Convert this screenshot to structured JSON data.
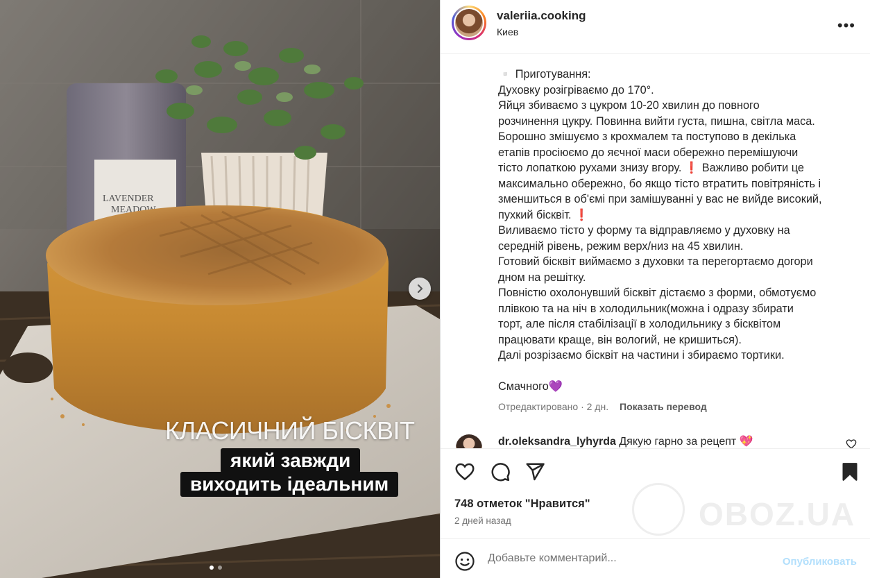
{
  "media": {
    "overlay_line1": "КЛАСИЧНИЙ БІСКВІТ",
    "overlay_line2": "який завжди",
    "overlay_line3": "виходить ідеальним",
    "jar_label_line1": "LAVENDER",
    "jar_label_line2": "MEADOW",
    "next_icon": "chevron-right-icon",
    "carousel_count": 2,
    "carousel_active": 1
  },
  "header": {
    "username": "valeriia.cooking",
    "location": "Киев",
    "more_icon": "more-horizontal-icon",
    "more_label": "•••"
  },
  "caption": {
    "lines": [
      "▫️ Приготування:",
      "Духовку розігріваємо до 170°.",
      "Яйця збиваємо з цукром 10-20 хвилин до повного",
      "розчинення цукру. Повинна вийти густа, пишна, світла маса.",
      "Борошно змішуємо з крохмалем та поступово в декілька",
      "етапів просіюємо до яєчної маси обережно перемішуючи",
      "тісто лопаткою рухами знизу вгору. ❗ Важливо робити це",
      "максимально обережно, бо якщо тісто втратить повітряність і",
      "зменшиться в об'ємі при замішуванні у вас не вийде високий,",
      "пухкий бісквіт. ❗",
      "Виливаємо тісто у форму та відправляємо у духовку на",
      "середній рівень, режим верх/низ на 45 хвилин.",
      "Готовий бісквіт виймаємо з духовки та перегортаємо догори",
      "дном на решітку.",
      "Повністю охолонувший бісквіт дістаємо з форми, обмотуємо",
      "плівкою та на ніч в холодильник(можна і одразу збирати",
      "торт, але після стабілізації в холодильнику з бісквітом",
      "працювати краще, він вологий, не кришиться).",
      "Далі розрізаємо бісквіт на частини і збираємо тортики."
    ],
    "closing": "Смачного💜",
    "edited": "Отредактировано · 2 дн.",
    "translate": "Показать перевод"
  },
  "comment": {
    "username": "dr.oleksandra_lyhyrda",
    "text": "Дякую гарно за рецепт 💖",
    "like_icon": "heart-outline-icon"
  },
  "actions": {
    "like_icon": "heart-icon",
    "comment_icon": "comment-icon",
    "share_icon": "share-icon",
    "save_icon": "bookmark-icon",
    "likes": "748 отметок \"Нравится\"",
    "date": "2 дней назад"
  },
  "watermark": {
    "text": "OBOZ.UA"
  },
  "comment_box": {
    "emoji_icon": "smiley-icon",
    "placeholder": "Добавьте комментарий...",
    "publish": "Опубликовать",
    "publish_color": "#b2dffc"
  },
  "colors": {
    "text": "#262626",
    "secondary": "#737373",
    "border": "#dbdbdb"
  }
}
